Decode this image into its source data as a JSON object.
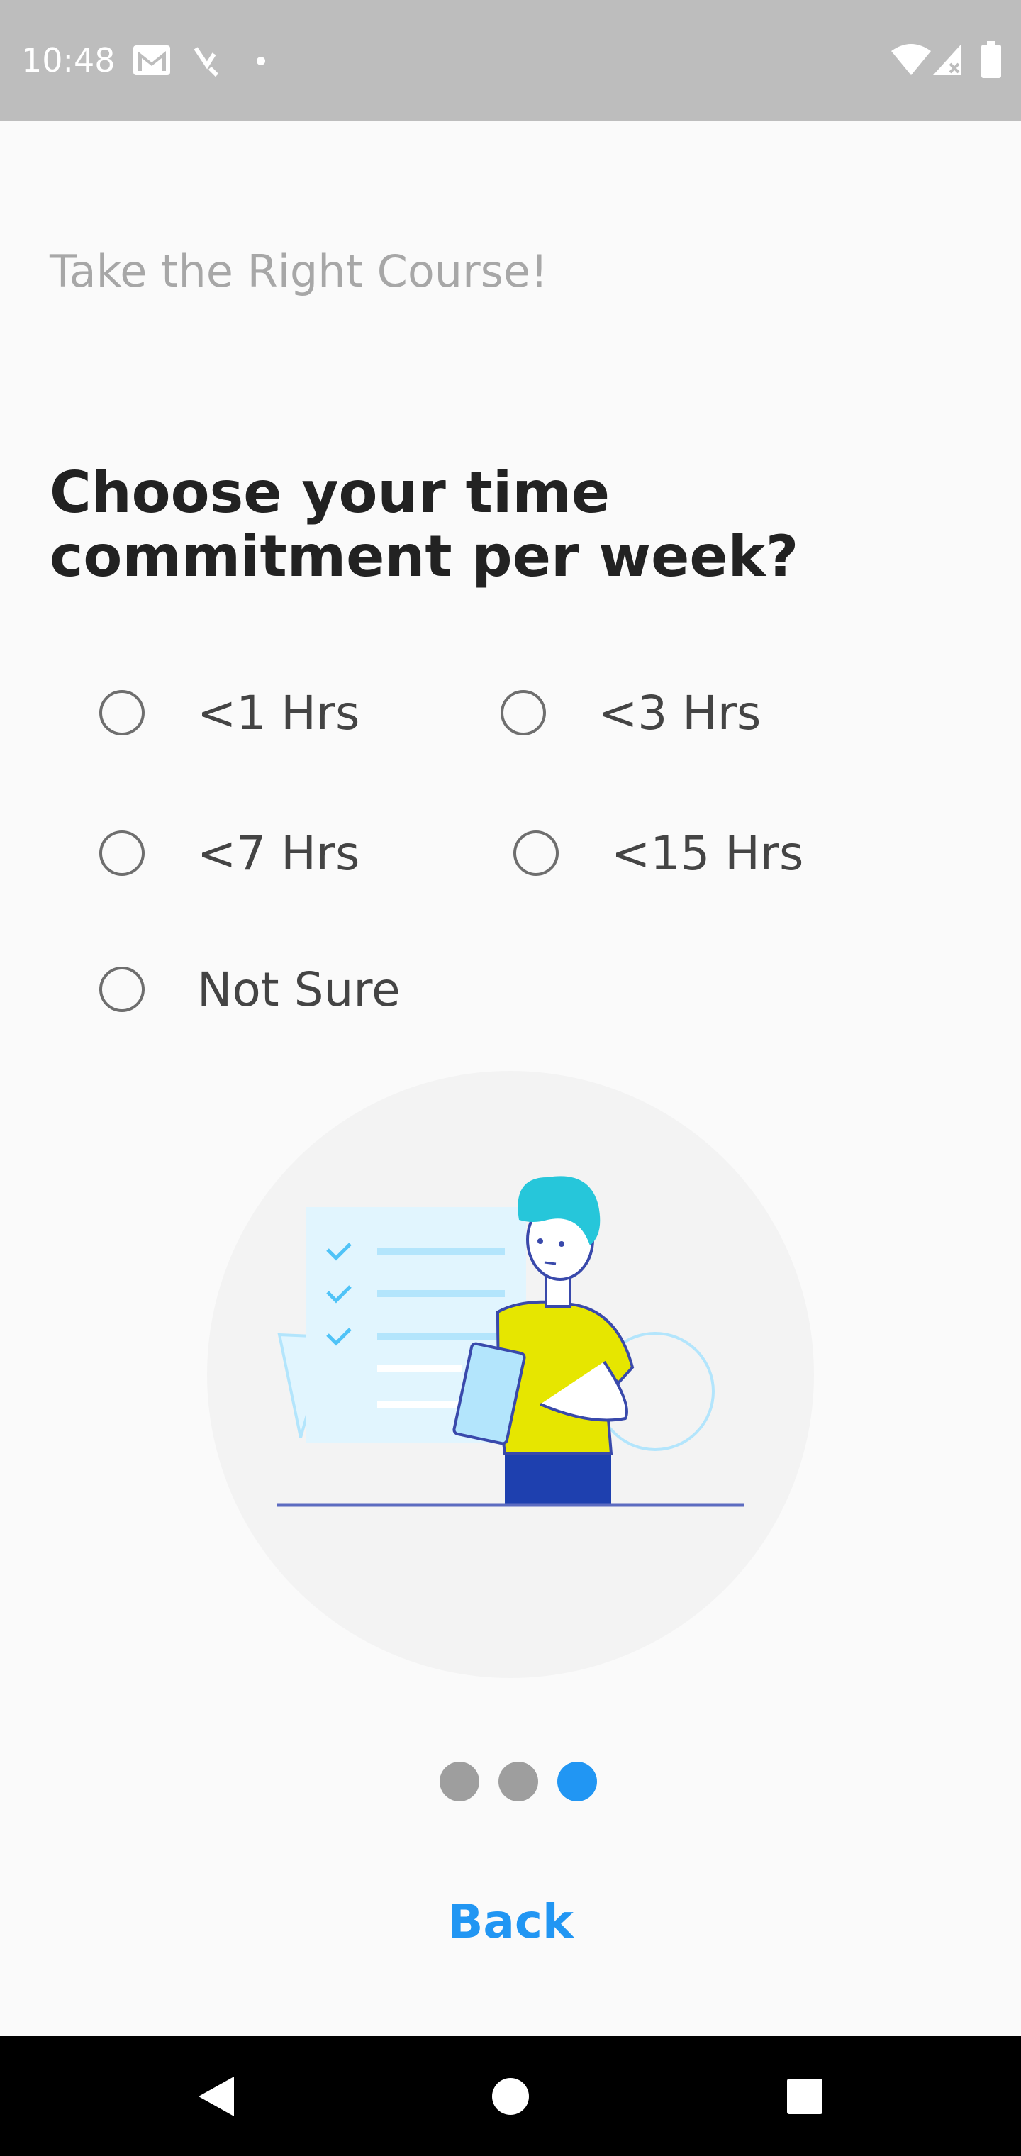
{
  "status_bar": {
    "time": "10:48",
    "left_icons": [
      "gmail-icon",
      "missed-call-icon",
      "notification-dot-icon"
    ],
    "right_icons": [
      "wifi-icon",
      "cell-signal-icon",
      "battery-icon"
    ],
    "background": "#bdbdbd"
  },
  "header": {
    "subtitle": "Take the Right Course!",
    "question": "Choose your time commitment per week?"
  },
  "options": [
    {
      "label": "<1 Hrs",
      "selected": false
    },
    {
      "label": "<3 Hrs",
      "selected": false
    },
    {
      "label": "<7 Hrs",
      "selected": false
    },
    {
      "label": "<15 Hrs",
      "selected": false
    },
    {
      "label": "Not Sure",
      "selected": false
    }
  ],
  "pagination": {
    "total": 3,
    "current": 3,
    "active_color": "#2196f3",
    "inactive_color": "#9e9e9e"
  },
  "actions": {
    "back_label": "Back",
    "accent": "#2196f3"
  },
  "nav_bar": {
    "buttons": [
      "back-triangle-icon",
      "home-circle-icon",
      "recents-square-icon"
    ]
  }
}
